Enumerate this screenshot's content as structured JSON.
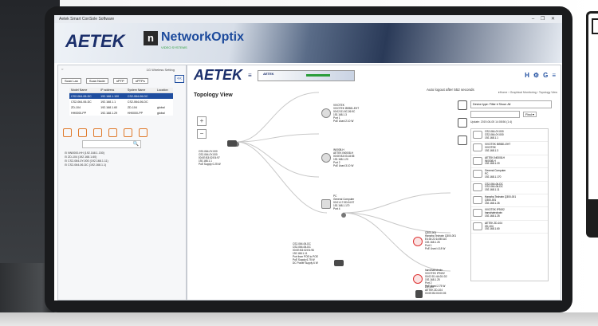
{
  "window": {
    "title": "Aetek Smart ConSole Software",
    "controls": "– ❐ ✕"
  },
  "banner": {
    "brand": "AETEK",
    "partner_mark": "n",
    "partner_name": "NetworkOptix",
    "partner_sub": "VIDEO SYSTEMS"
  },
  "left_pane": {
    "header_left": "○",
    "header_right": "1G Wireless Setting",
    "toolbar": [
      "Scan Lan",
      "Scan Node",
      "nPTP",
      "nPTPs"
    ],
    "close_label": "<<",
    "table": {
      "columns": [
        "Model Name",
        "IP address",
        "System Name",
        "Location"
      ],
      "rows": [
        [
          "CS2-064-06-DC",
          "192.168.1.100",
          "CS2-064-06-DC",
          ""
        ],
        [
          "CS2-064-06-DC",
          "192.168.1.1",
          "CS2-064-06-DC",
          ""
        ],
        [
          "ZD-104",
          "192.168.1.60",
          "ZD-104",
          "global"
        ],
        [
          "HH0000-PP",
          "192.168.1.29",
          "HH0000-PP",
          "global"
        ]
      ]
    },
    "search_icon": "🔍",
    "tree": [
      "⊟ NN0000-HH (192.168.1.150)",
      "⊟ ZD-104 (192.168.1.60)",
      "⊟ CS2-084-0Y-000 (192.168.1.11)",
      "⊟ CS2-064-06-DC (192.168.1.1)"
    ]
  },
  "main": {
    "brand": "AETEK",
    "menu_icon": "≡",
    "mini_banner_brand": "AETEK",
    "auto_logout": "Auto logout after 552 seconds",
    "top_icons": [
      "H",
      "⚙",
      "G",
      "≡"
    ],
    "title": "Topology View",
    "breadcrumb": "●Home › Graphical Monitoring › Topology View",
    "zoom_in": "+",
    "zoom_out": "−",
    "nodes": {
      "root": [
        "CS2-064-0Y-000",
        "CS2-064-0Y-000",
        "00:0E:B3:02:E4:97",
        "192.168.1.1",
        "PoE Supply 0.25 W"
      ],
      "cam1": [
        "VIVOTEK",
        "VIVOTEK IB9381-EHT",
        "00:02:D1:5C:26:9C",
        "192.168.1.3",
        "Port 1",
        "PoE Used 2.10 W"
      ],
      "cam2": [
        "IN0008-H",
        "AETEK IN0008-H",
        "00:0E:B3:03:18:55",
        "192.168.1.20",
        "Port 2",
        "PoE Used 3.10 W"
      ],
      "pc": [
        "PC",
        "General Computer",
        "00:01:17:3D:04:97",
        "192.168.1.170",
        "Port 4"
      ],
      "switch2": [
        "CS2-064-06-DC",
        "CS2-064-06-DC",
        "00:0E:B3:02:E4:96",
        "192.168.1.11",
        "Port from POE to POE",
        "PoE Supply 6.75 W",
        "DC Power Supply 6 W"
      ],
      "dome1": [
        "Q300-001",
        "Hanwha Techwin Q300-001",
        "E4:30:22:14:B0:A4",
        "192.168.1.26",
        "Port 1",
        "PoE Used 4.18 W"
      ],
      "dome2": [
        "hanwhatechwin",
        "VIVOTEK IP9192",
        "00:02:D1:4A:D1:D2",
        "192.168.1.25",
        "Port 2",
        "PoE Used 2.75 W"
      ],
      "srv": [
        "ZD-104",
        "AETEK ZD-104",
        "00:0E:B3:00:00:05",
        "192.168.1.60",
        "Port 1"
      ]
    },
    "right": {
      "select_label": "Device type: Filter ▾ Show: All",
      "search_btn": "Find ▾",
      "update": "Update: 2019-06-05 14:08:56 (1:4)",
      "list": [
        [
          "CS2-064-0Y-000",
          "CS2-064-0Y-000",
          "192.168.1.1"
        ],
        [
          "VIVOTEK IB9381-EHT",
          "VIVOTEK",
          "192.168.1.3"
        ],
        [
          "AETEK IN0008-H",
          "IN0008-H",
          "192.168.1.20"
        ],
        [
          "General Computer",
          "PC",
          "192.168.1.170"
        ],
        [
          "CS2-064-06-DC",
          "CS2-064-06-DC",
          "192.168.1.11"
        ],
        [
          "Hanwha Techwin Q300-001",
          "Q300-001",
          "192.168.1.26"
        ],
        [
          "VIVOTEK IP9192",
          "hanwhatechwin",
          "192.168.1.25"
        ],
        [
          "AETEK ZD-104",
          "ZD-104",
          "192.168.1.60"
        ]
      ]
    }
  }
}
